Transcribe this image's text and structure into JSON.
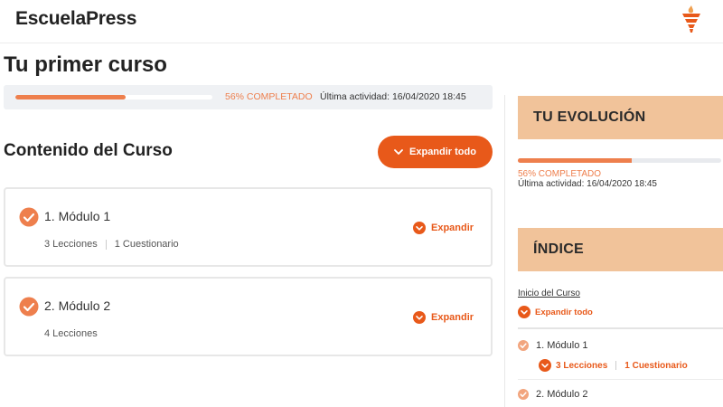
{
  "header": {
    "brand": "EscuelaPress",
    "logo_icon": "torch-icon"
  },
  "course": {
    "title": "Tu primer curso",
    "progress_percent": 56,
    "progress_text": "56% COMPLETADO",
    "last_activity": "Última actividad: 16/04/2020 18:45"
  },
  "content": {
    "title": "Contenido del Curso",
    "expand_all_label": "Expandir todo",
    "modules": [
      {
        "title": "1. Módulo 1",
        "lessons": "3 Lecciones",
        "quizzes": "1 Cuestionario",
        "expand_label": "Expandir",
        "completed": true
      },
      {
        "title": "2. Módulo 2",
        "lessons": "4 Lecciones",
        "expand_label": "Expandir",
        "completed": true
      }
    ]
  },
  "sidebar": {
    "evolution_title": "TU EVOLUCIÓN",
    "progress_percent": 56,
    "progress_text": "56% COMPLETADO",
    "last_activity": "Última actividad: 16/04/2020 18:45",
    "index_title": "ÍNDICE",
    "course_start": "Inicio del Curso",
    "expand_all_label": "Expandir todo",
    "modules": [
      {
        "title": "1. Módulo 1",
        "lessons": "3 Lecciones",
        "quizzes": "1 Cuestionario"
      },
      {
        "title": "2. Módulo 2"
      }
    ]
  },
  "colors": {
    "accent": "#e8591a",
    "progress": "#ee7f4d",
    "sidebar_header": "#f1c39a",
    "check": "#ee7f4d"
  }
}
